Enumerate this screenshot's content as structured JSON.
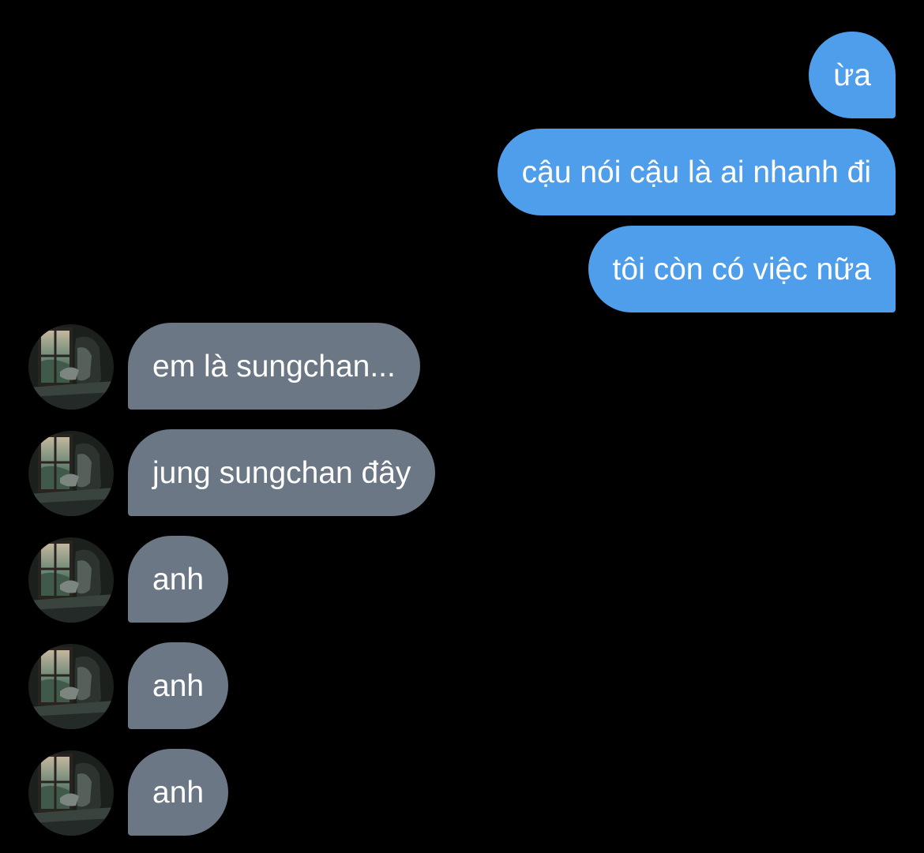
{
  "colors": {
    "background": "#000000",
    "sent_bubble": "#4f9eec",
    "received_bubble": "#6b7784",
    "text": "#ffffff"
  },
  "messages": [
    {
      "direction": "sent",
      "text": "ừa"
    },
    {
      "direction": "sent",
      "text": "cậu nói cậu là ai nhanh đi"
    },
    {
      "direction": "sent",
      "text": "tôi còn có việc nữa"
    },
    {
      "direction": "received",
      "text": "em là sungchan..."
    },
    {
      "direction": "received",
      "text": "jung sungchan đây"
    },
    {
      "direction": "received",
      "text": "anh"
    },
    {
      "direction": "received",
      "text": "anh"
    },
    {
      "direction": "received",
      "text": "anh"
    }
  ],
  "avatar": {
    "icon": "contact-avatar-icon"
  }
}
